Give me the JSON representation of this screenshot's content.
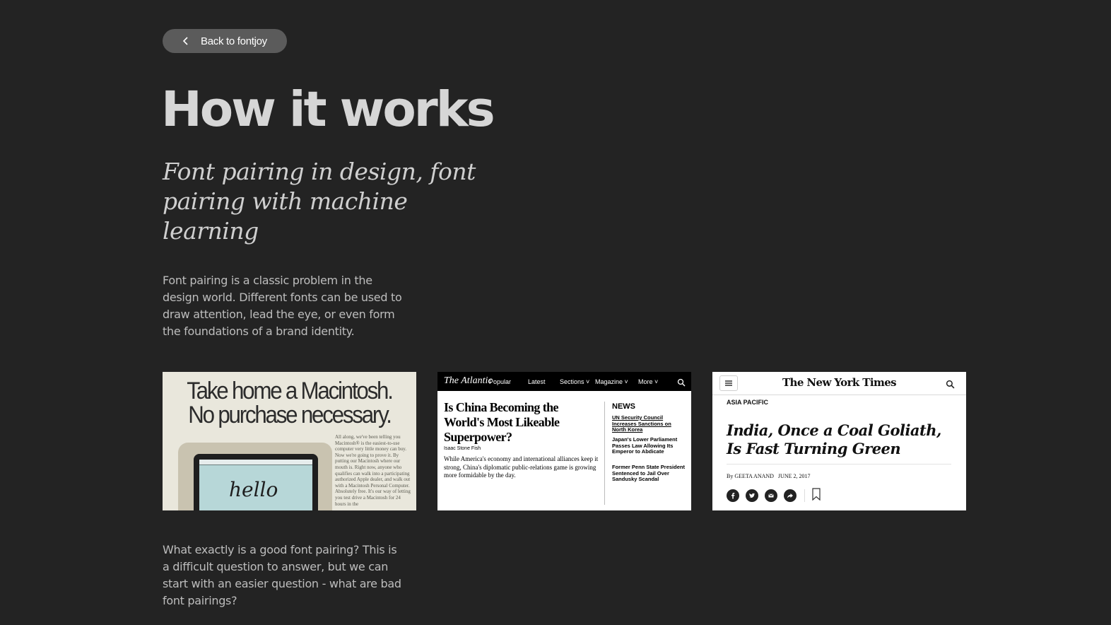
{
  "back_button": {
    "label": "Back to fontjoy"
  },
  "title": "How it works",
  "subtitle": "Font pairing in design, font pairing with machine learning",
  "paragraphs": [
    "Font pairing is a classic problem in the design world. Different fonts can be used to draw attention, lead the eye, or even form the foundations of a brand identity.",
    "What exactly is a good font pairing? This is a difficult question to answer, but we can start with an easier question - what are bad font pairings?"
  ],
  "examples": {
    "macintosh": {
      "headline_1": "Take home a Macintosh.",
      "headline_2": "No purchase necessary.",
      "body": "All along, we've been telling you Macintosh® is the easiest-to-use computer very little money can buy. Now we're going to prove it. By putting our Macintosh where our mouth is. Right now, anyone who qualifies can walk into a participating authorized Apple dealer, and walk out with a Macintosh Personal Computer. Absolutely free. It's our way of letting you test drive a Macintosh for 24 hours in the",
      "screen_text": "hello"
    },
    "atlantic": {
      "logo": "The Atlantic",
      "nav": [
        "Popular",
        "Latest",
        "Sections ˅",
        "Magazine ˅",
        "More ˅"
      ],
      "headline": "Is China Becoming the World's Most Likeable Superpower?",
      "byline": "Isaac Stone Fish",
      "dek": "While America's economy and international alliances keep it strong, China's diplomatic public-relations game is growing more formidable by the day.",
      "news_label": "NEWS",
      "news_items": [
        "UN Security Council Increases Sanctions on North Korea",
        "Japan's Lower Parliament Passes Law Allowing Its Emperor to Abdicate",
        "Former Penn State President Sentenced to Jail Over Sandusky Scandal"
      ]
    },
    "nyt": {
      "logo": "The New York Times",
      "section": "ASIA PACIFIC",
      "headline": "India, Once a Coal Goliath, Is Fast Turning Green",
      "byline_prefix": "By",
      "author": "GEETA ANAND",
      "date": "JUNE 2, 2017"
    }
  }
}
